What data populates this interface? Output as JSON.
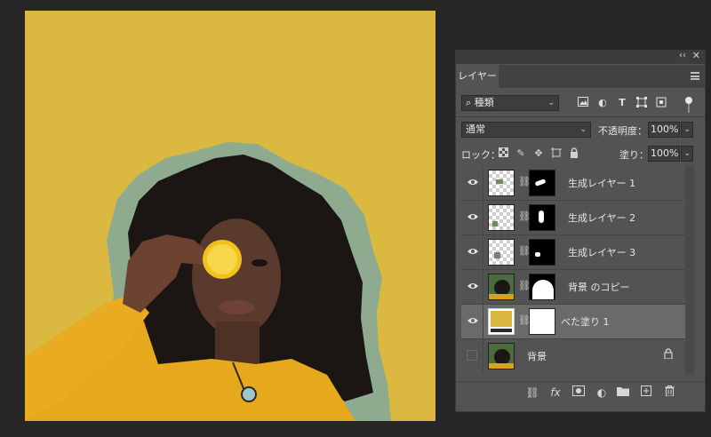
{
  "canvas": {
    "background_color": "#dbb940",
    "halo_color": "#8fab8f",
    "subject": "photo-woman-with-lemon-slice"
  },
  "panel": {
    "collapse_glyph": "‹‹",
    "close_glyph": "✕",
    "tab_label": "レイヤー",
    "filter": {
      "kind_value": "種類",
      "icons": [
        "image-filter-icon",
        "adjustment-filter-icon",
        "type-filter-icon",
        "shape-filter-icon",
        "smart-object-filter-icon"
      ]
    },
    "blend_mode": "通常",
    "opacity_label": "不透明度：",
    "opacity_value": "100%",
    "lock_label": "ロック：",
    "fill_label": "塗り：",
    "fill_value": "100%",
    "layers": [
      {
        "name": "生成レイヤー 1",
        "visible": true,
        "selected": false,
        "locked": false
      },
      {
        "name": "生成レイヤー 2",
        "visible": true,
        "selected": false,
        "locked": false
      },
      {
        "name": "生成レイヤー 3",
        "visible": true,
        "selected": false,
        "locked": false
      },
      {
        "name": "背景 のコピー",
        "visible": true,
        "selected": false,
        "locked": false
      },
      {
        "name": "べた塗り 1",
        "visible": true,
        "selected": true,
        "locked": false
      },
      {
        "name": "背景",
        "visible": false,
        "selected": false,
        "locked": true
      }
    ],
    "bottom_icons": [
      "link-layers-icon",
      "fx-icon",
      "add-mask-icon",
      "adjustment-layer-icon",
      "new-group-icon",
      "new-layer-icon",
      "delete-layer-icon"
    ],
    "fx_label": "fx"
  }
}
